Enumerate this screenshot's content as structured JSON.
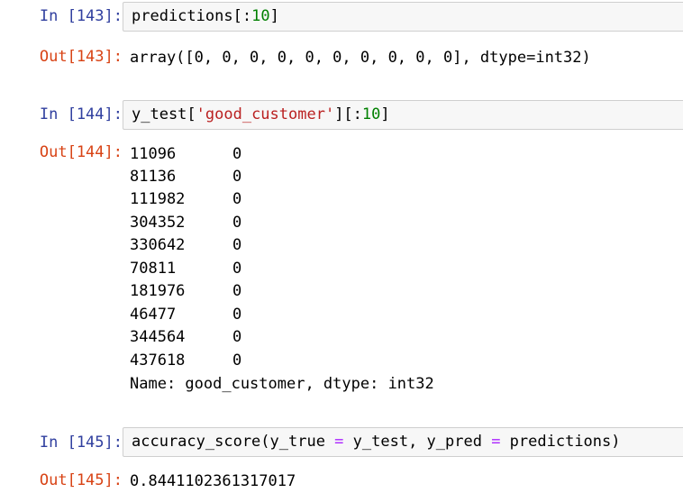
{
  "cells": [
    {
      "in_prompt": "In [143]:",
      "code": {
        "fn": "predictions",
        "open": "[:",
        "num": "10",
        "close": "]"
      },
      "out_prompt": "Out[143]:",
      "output": "array([0, 0, 0, 0, 0, 0, 0, 0, 0, 0], dtype=int32)"
    },
    {
      "in_prompt": "In [144]:",
      "code": {
        "var": "y_test[",
        "str": "'good_customer'",
        "mid": "][:",
        "num": "10",
        "close": "]"
      },
      "out_prompt": "Out[144]:",
      "series": [
        {
          "index": "11096",
          "value": "0"
        },
        {
          "index": "81136",
          "value": "0"
        },
        {
          "index": "111982",
          "value": "0"
        },
        {
          "index": "304352",
          "value": "0"
        },
        {
          "index": "330642",
          "value": "0"
        },
        {
          "index": "70811",
          "value": "0"
        },
        {
          "index": "181976",
          "value": "0"
        },
        {
          "index": "46477",
          "value": "0"
        },
        {
          "index": "344564",
          "value": "0"
        },
        {
          "index": "437618",
          "value": "0"
        }
      ],
      "series_footer": "Name: good_customer, dtype: int32"
    },
    {
      "in_prompt": "In [145]:",
      "code": {
        "p1": "accuracy_score(y_true ",
        "op1": "=",
        "p2": " y_test, y_pred ",
        "op2": "=",
        "p3": " predictions)"
      },
      "out_prompt": "Out[145]:",
      "output": "0.8441102361317017"
    }
  ]
}
